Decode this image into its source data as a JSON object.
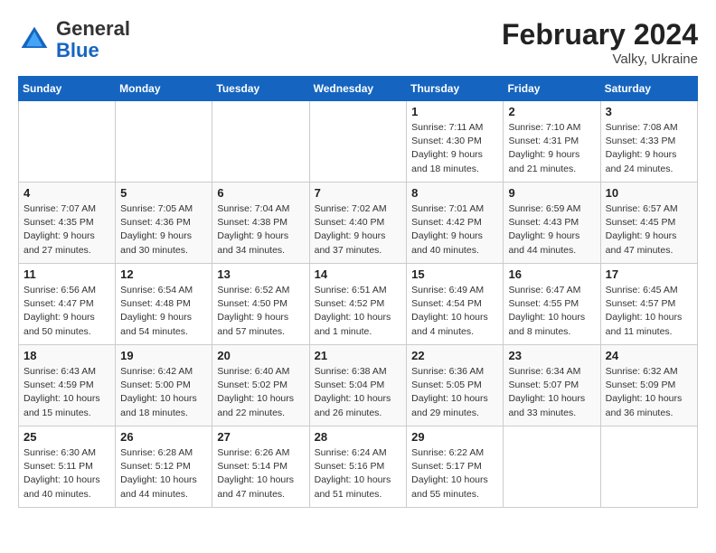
{
  "header": {
    "logo_general": "General",
    "logo_blue": "Blue",
    "month_year": "February 2024",
    "location": "Valky, Ukraine"
  },
  "days_of_week": [
    "Sunday",
    "Monday",
    "Tuesday",
    "Wednesday",
    "Thursday",
    "Friday",
    "Saturday"
  ],
  "weeks": [
    [
      {
        "day": "",
        "info": ""
      },
      {
        "day": "",
        "info": ""
      },
      {
        "day": "",
        "info": ""
      },
      {
        "day": "",
        "info": ""
      },
      {
        "day": "1",
        "info": "Sunrise: 7:11 AM\nSunset: 4:30 PM\nDaylight: 9 hours\nand 18 minutes."
      },
      {
        "day": "2",
        "info": "Sunrise: 7:10 AM\nSunset: 4:31 PM\nDaylight: 9 hours\nand 21 minutes."
      },
      {
        "day": "3",
        "info": "Sunrise: 7:08 AM\nSunset: 4:33 PM\nDaylight: 9 hours\nand 24 minutes."
      }
    ],
    [
      {
        "day": "4",
        "info": "Sunrise: 7:07 AM\nSunset: 4:35 PM\nDaylight: 9 hours\nand 27 minutes."
      },
      {
        "day": "5",
        "info": "Sunrise: 7:05 AM\nSunset: 4:36 PM\nDaylight: 9 hours\nand 30 minutes."
      },
      {
        "day": "6",
        "info": "Sunrise: 7:04 AM\nSunset: 4:38 PM\nDaylight: 9 hours\nand 34 minutes."
      },
      {
        "day": "7",
        "info": "Sunrise: 7:02 AM\nSunset: 4:40 PM\nDaylight: 9 hours\nand 37 minutes."
      },
      {
        "day": "8",
        "info": "Sunrise: 7:01 AM\nSunset: 4:42 PM\nDaylight: 9 hours\nand 40 minutes."
      },
      {
        "day": "9",
        "info": "Sunrise: 6:59 AM\nSunset: 4:43 PM\nDaylight: 9 hours\nand 44 minutes."
      },
      {
        "day": "10",
        "info": "Sunrise: 6:57 AM\nSunset: 4:45 PM\nDaylight: 9 hours\nand 47 minutes."
      }
    ],
    [
      {
        "day": "11",
        "info": "Sunrise: 6:56 AM\nSunset: 4:47 PM\nDaylight: 9 hours\nand 50 minutes."
      },
      {
        "day": "12",
        "info": "Sunrise: 6:54 AM\nSunset: 4:48 PM\nDaylight: 9 hours\nand 54 minutes."
      },
      {
        "day": "13",
        "info": "Sunrise: 6:52 AM\nSunset: 4:50 PM\nDaylight: 9 hours\nand 57 minutes."
      },
      {
        "day": "14",
        "info": "Sunrise: 6:51 AM\nSunset: 4:52 PM\nDaylight: 10 hours\nand 1 minute."
      },
      {
        "day": "15",
        "info": "Sunrise: 6:49 AM\nSunset: 4:54 PM\nDaylight: 10 hours\nand 4 minutes."
      },
      {
        "day": "16",
        "info": "Sunrise: 6:47 AM\nSunset: 4:55 PM\nDaylight: 10 hours\nand 8 minutes."
      },
      {
        "day": "17",
        "info": "Sunrise: 6:45 AM\nSunset: 4:57 PM\nDaylight: 10 hours\nand 11 minutes."
      }
    ],
    [
      {
        "day": "18",
        "info": "Sunrise: 6:43 AM\nSunset: 4:59 PM\nDaylight: 10 hours\nand 15 minutes."
      },
      {
        "day": "19",
        "info": "Sunrise: 6:42 AM\nSunset: 5:00 PM\nDaylight: 10 hours\nand 18 minutes."
      },
      {
        "day": "20",
        "info": "Sunrise: 6:40 AM\nSunset: 5:02 PM\nDaylight: 10 hours\nand 22 minutes."
      },
      {
        "day": "21",
        "info": "Sunrise: 6:38 AM\nSunset: 5:04 PM\nDaylight: 10 hours\nand 26 minutes."
      },
      {
        "day": "22",
        "info": "Sunrise: 6:36 AM\nSunset: 5:05 PM\nDaylight: 10 hours\nand 29 minutes."
      },
      {
        "day": "23",
        "info": "Sunrise: 6:34 AM\nSunset: 5:07 PM\nDaylight: 10 hours\nand 33 minutes."
      },
      {
        "day": "24",
        "info": "Sunrise: 6:32 AM\nSunset: 5:09 PM\nDaylight: 10 hours\nand 36 minutes."
      }
    ],
    [
      {
        "day": "25",
        "info": "Sunrise: 6:30 AM\nSunset: 5:11 PM\nDaylight: 10 hours\nand 40 minutes."
      },
      {
        "day": "26",
        "info": "Sunrise: 6:28 AM\nSunset: 5:12 PM\nDaylight: 10 hours\nand 44 minutes."
      },
      {
        "day": "27",
        "info": "Sunrise: 6:26 AM\nSunset: 5:14 PM\nDaylight: 10 hours\nand 47 minutes."
      },
      {
        "day": "28",
        "info": "Sunrise: 6:24 AM\nSunset: 5:16 PM\nDaylight: 10 hours\nand 51 minutes."
      },
      {
        "day": "29",
        "info": "Sunrise: 6:22 AM\nSunset: 5:17 PM\nDaylight: 10 hours\nand 55 minutes."
      },
      {
        "day": "",
        "info": ""
      },
      {
        "day": "",
        "info": ""
      }
    ]
  ]
}
